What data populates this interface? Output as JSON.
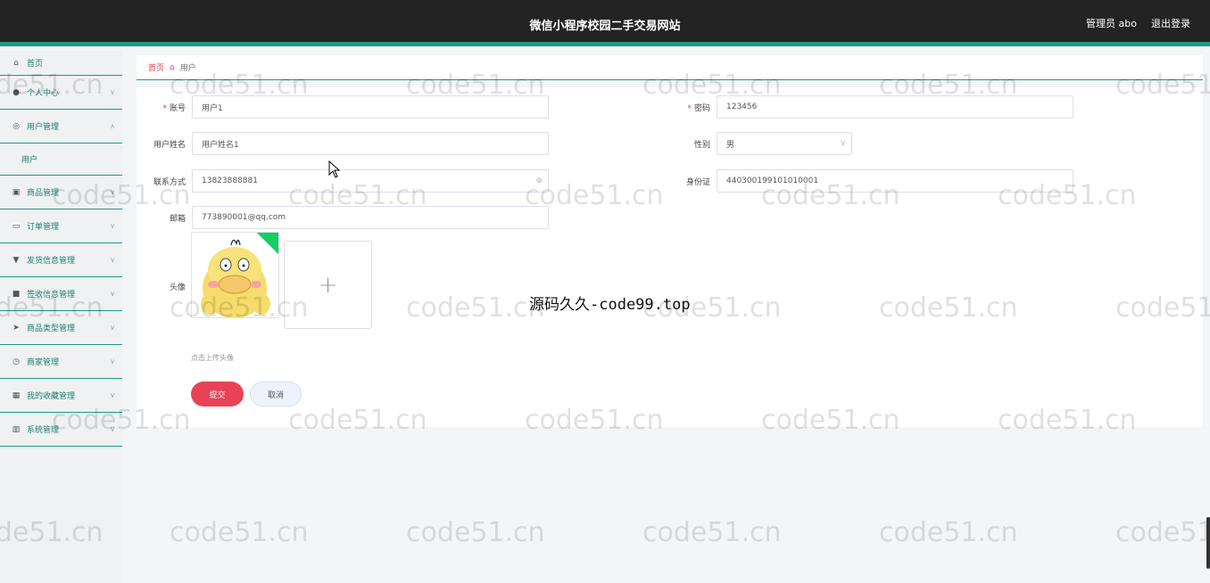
{
  "header": {
    "title": "微信小程序校园二手交易网站",
    "user": "管理员 abo",
    "logout": "退出登录"
  },
  "sidebar": {
    "items": [
      {
        "label": "首页",
        "icon": "home-icon"
      },
      {
        "label": "个人中心",
        "icon": "person-icon"
      },
      {
        "label": "用户管理",
        "icon": "user-manage-icon"
      },
      {
        "label": "用户",
        "sub": true
      },
      {
        "label": "商品管理",
        "icon": "goods-icon"
      },
      {
        "label": "订单管理",
        "icon": "order-icon"
      },
      {
        "label": "发货信息管理",
        "icon": "shipping-icon"
      },
      {
        "label": "签收信息管理",
        "icon": "receipt-icon"
      },
      {
        "label": "商品类型管理",
        "icon": "category-icon"
      },
      {
        "label": "商家管理",
        "icon": "clock-icon"
      },
      {
        "label": "我的收藏管理",
        "icon": "favorite-icon"
      },
      {
        "label": "系统管理",
        "icon": "system-icon"
      }
    ]
  },
  "breadcrumb": {
    "home": "首页",
    "current": "用户"
  },
  "form": {
    "account_label": "账号",
    "account_value": "用户1",
    "password_label": "密码",
    "password_value": "123456",
    "name_label": "用户姓名",
    "name_value": "用户姓名1",
    "gender_label": "性别",
    "gender_value": "男",
    "contact_label": "联系方式",
    "contact_value": "13823888881",
    "idcard_label": "身份证",
    "idcard_value": "440300199101010001",
    "email_label": "邮箱",
    "email_value": "773890001@qq.com",
    "avatar_label": "头像",
    "upload_hint": "点击上传头像",
    "submit": "提交",
    "cancel": "取消"
  },
  "overlay": "源码久久-code99.top",
  "watermark": "code51.cn",
  "colors": {
    "accent": "#1d9a86",
    "danger": "#e94257",
    "header_bg": "#232323"
  }
}
